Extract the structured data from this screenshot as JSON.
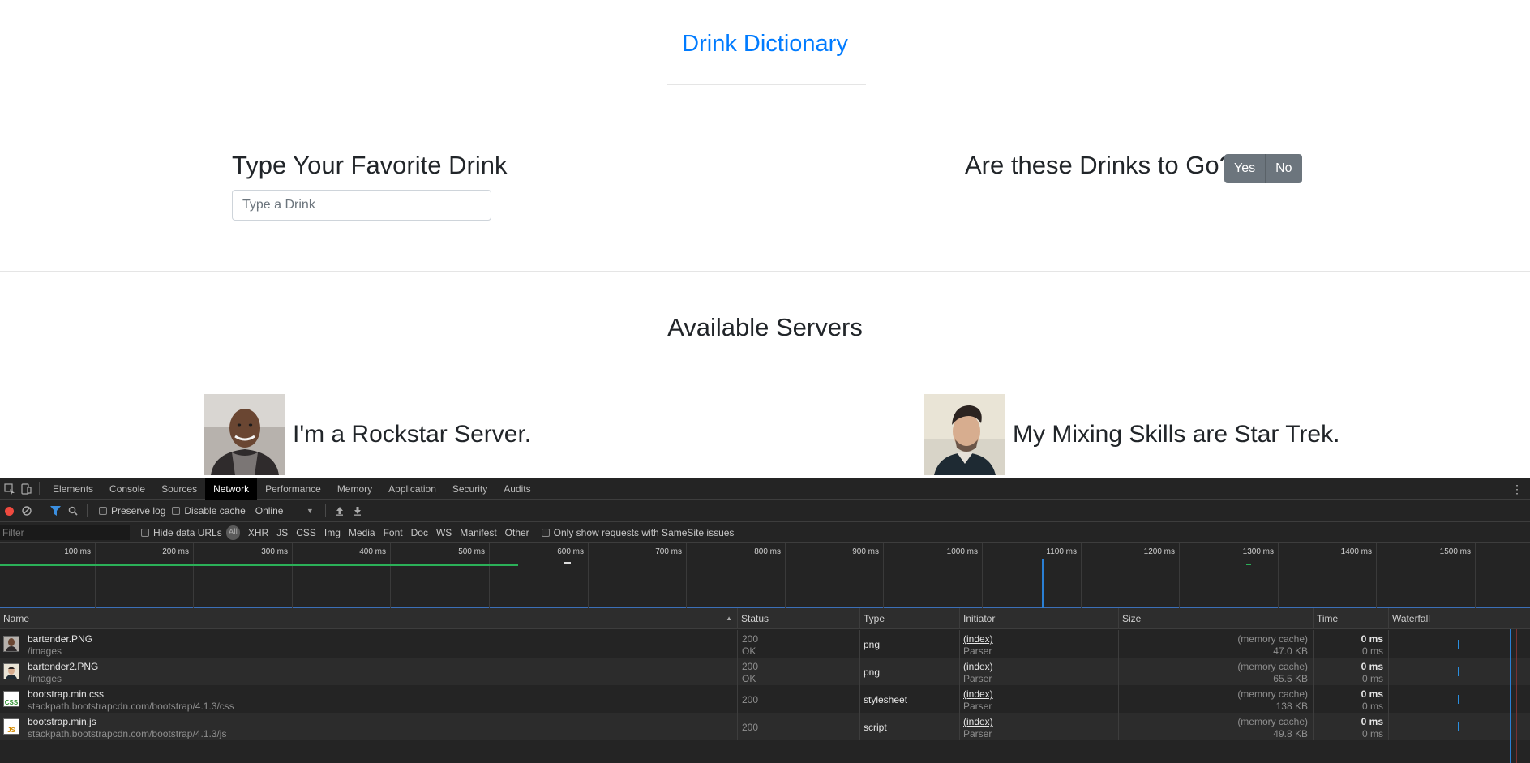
{
  "page": {
    "brand": "Drink Dictionary",
    "drink_title": "Type Your Favorite Drink",
    "drink_placeholder": "Type a Drink",
    "togo_title": "Are these Drinks to Go?",
    "yes_label": "Yes",
    "no_label": "No",
    "servers_title": "Available Servers",
    "servers": [
      {
        "caption": "I'm a Rockstar Server."
      },
      {
        "caption": "My Mixing Skills are Star Trek."
      }
    ]
  },
  "devtools": {
    "tabs": [
      "Elements",
      "Console",
      "Sources",
      "Network",
      "Performance",
      "Memory",
      "Application",
      "Security",
      "Audits"
    ],
    "active_tab": "Network",
    "toolbar": {
      "preserve_log": "Preserve log",
      "disable_cache": "Disable cache",
      "throttle": "Online"
    },
    "filterbar": {
      "filter_placeholder": "Filter",
      "hide_data_urls": "Hide data URLs",
      "all_label": "All",
      "types": [
        "XHR",
        "JS",
        "CSS",
        "Img",
        "Media",
        "Font",
        "Doc",
        "WS",
        "Manifest",
        "Other"
      ],
      "samesite": "Only show requests with SameSite issues"
    },
    "overview_ticks": [
      "100 ms",
      "200 ms",
      "300 ms",
      "400 ms",
      "500 ms",
      "600 ms",
      "700 ms",
      "800 ms",
      "900 ms",
      "1000 ms",
      "1100 ms",
      "1200 ms",
      "1300 ms",
      "1400 ms",
      "1500 ms"
    ],
    "columns": {
      "name": "Name",
      "status": "Status",
      "type": "Type",
      "initiator": "Initiator",
      "size": "Size",
      "time": "Time",
      "waterfall": "Waterfall"
    },
    "requests": [
      {
        "name": "bartender.PNG",
        "path": "/images",
        "status": "200",
        "status_text": "OK",
        "type": "png",
        "initiator": "(index)",
        "initiator_sub": "Parser",
        "size_top": "(memory cache)",
        "size_bottom": "47.0 KB",
        "time_top": "0 ms",
        "time_bottom": "0 ms",
        "icon": "image-file-icon"
      },
      {
        "name": "bartender2.PNG",
        "path": "/images",
        "status": "200",
        "status_text": "OK",
        "type": "png",
        "initiator": "(index)",
        "initiator_sub": "Parser",
        "size_top": "(memory cache)",
        "size_bottom": "65.5 KB",
        "time_top": "0 ms",
        "time_bottom": "0 ms",
        "icon": "image-file-icon"
      },
      {
        "name": "bootstrap.min.css",
        "path": "stackpath.bootstrapcdn.com/bootstrap/4.1.3/css",
        "status": "200",
        "status_text": "",
        "type": "stylesheet",
        "initiator": "(index)",
        "initiator_sub": "Parser",
        "size_top": "(memory cache)",
        "size_bottom": "138 KB",
        "time_top": "0 ms",
        "time_bottom": "0 ms",
        "icon": "css-file-icon"
      },
      {
        "name": "bootstrap.min.js",
        "path": "stackpath.bootstrapcdn.com/bootstrap/4.1.3/js",
        "status": "200",
        "status_text": "",
        "type": "script",
        "initiator": "(index)",
        "initiator_sub": "Parser",
        "size_top": "(memory cache)",
        "size_bottom": "49.8 KB",
        "time_top": "0 ms",
        "time_bottom": "0 ms",
        "icon": "js-file-icon"
      }
    ],
    "colors": {
      "load_line": "#2a7fd4",
      "domcontent_line": "#e04a4a",
      "record": "#ef4a3f"
    }
  }
}
